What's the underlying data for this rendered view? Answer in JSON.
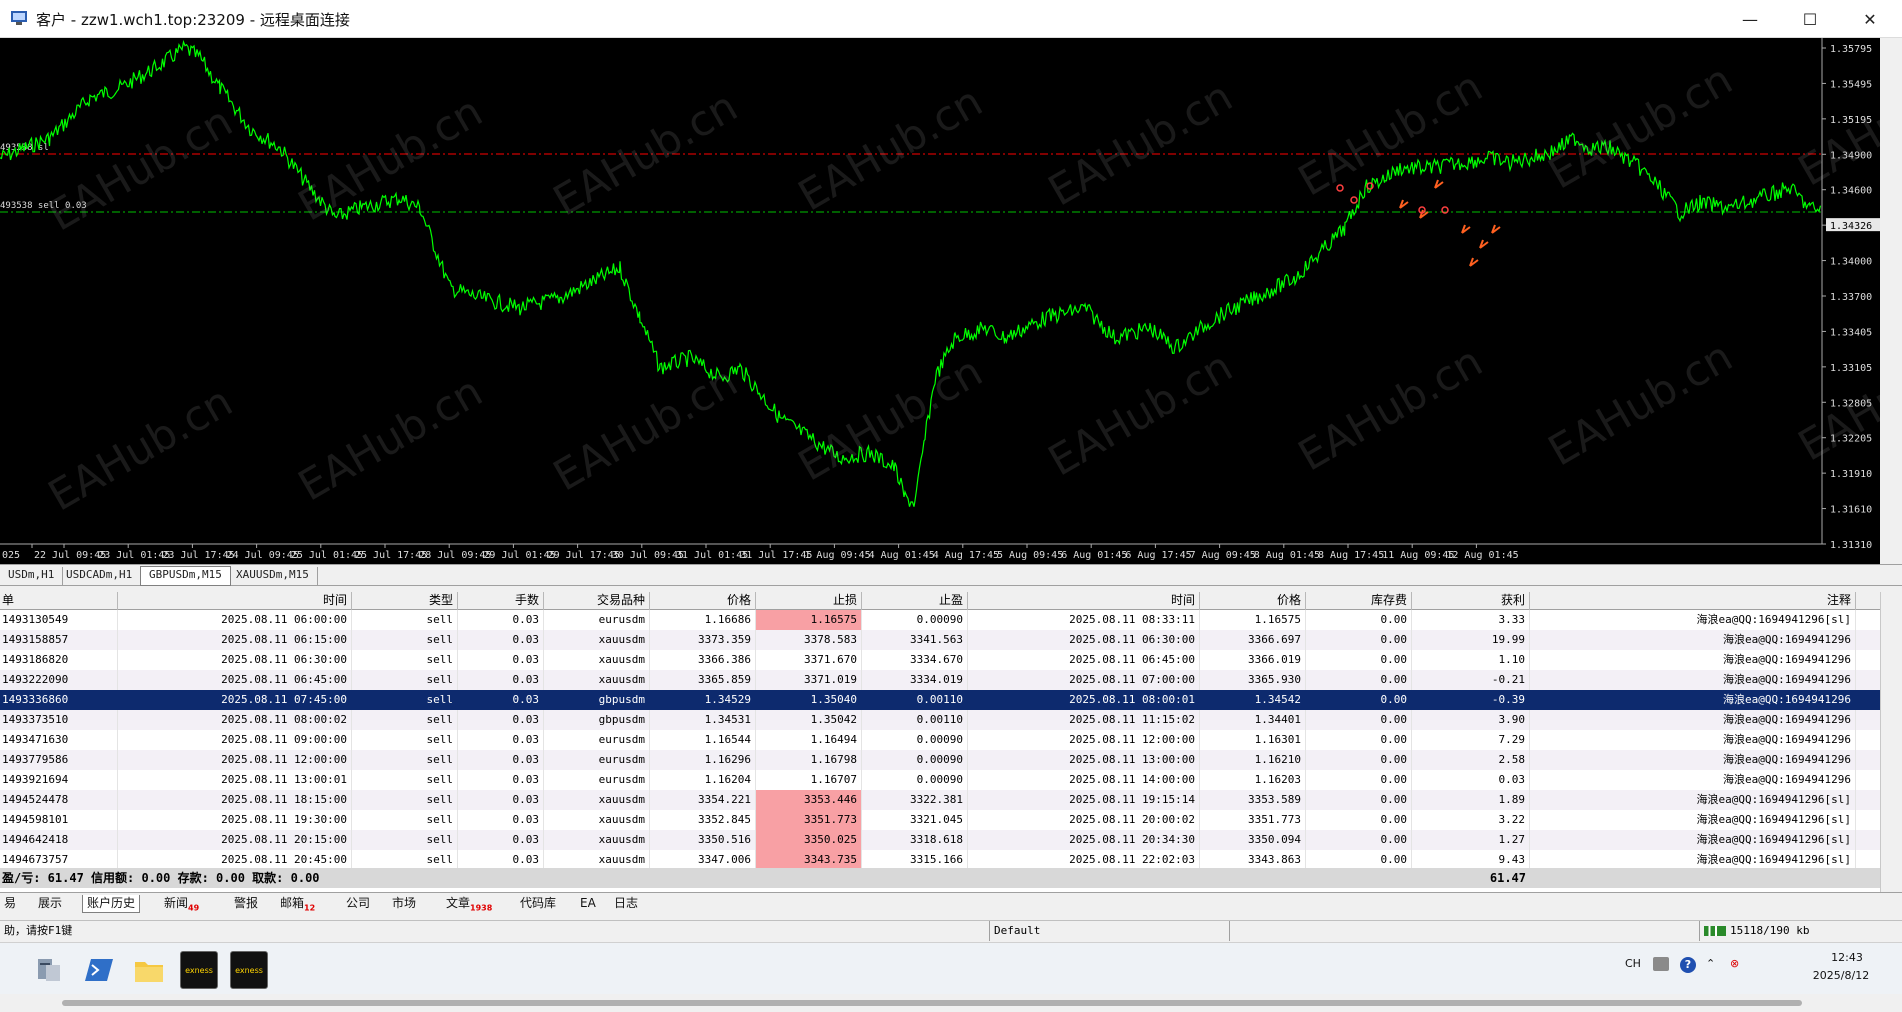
{
  "window": {
    "title": "客户 - zzw1.wch1.top:23209 - 远程桌面连接",
    "minimize_glyph": "—",
    "maximize_glyph": "☐",
    "close_glyph": "✕"
  },
  "chart": {
    "watermark": "EAHub.cn",
    "price_axis": [
      "1.35795",
      "1.35495",
      "1.35195",
      "1.34900",
      "1.34600",
      "1.34326",
      "1.34000",
      "1.33700",
      "1.33405",
      "1.33105",
      "1.32805",
      "1.32205",
      "1.31910",
      "1.31610",
      "1.31310"
    ],
    "current_price": "1.34326",
    "time_axis": [
      "025",
      "22 Jul 09:45",
      "23 Jul 01:45",
      "23 Jul 17:45",
      "24 Jul 09:45",
      "25 Jul 01:45",
      "25 Jul 17:45",
      "28 Jul 09:45",
      "29 Jul 01:45",
      "29 Jul 17:45",
      "30 Jul 09:45",
      "31 Jul 01:45",
      "31 Jul 17:45",
      "1 Aug 09:45",
      "4 Aug 01:45",
      "4 Aug 17:45",
      "5 Aug 09:45",
      "6 Aug 01:45",
      "6 Aug 17:45",
      "7 Aug 09:45",
      "8 Aug 01:45",
      "8 Aug 17:45",
      "11 Aug 09:45",
      "12 Aug 01:45"
    ],
    "order_labels": [
      "493538 sl",
      "493538 sell 0.03"
    ],
    "colors": {
      "price": "#00ff00",
      "sl_line": "#ff0000",
      "entry_line": "#00c000"
    }
  },
  "symbol_tabs": [
    "USDm,H1",
    "USDCADm,H1",
    "GBPUSDm,M15",
    "XAUUSDm,M15"
  ],
  "symbol_tabs_active": "GBPUSDm,M15",
  "table": {
    "headers": [
      "单",
      "时间",
      "类型",
      "手数",
      "交易品种",
      "价格",
      "止损",
      "止盈",
      "时间",
      "价格",
      "库存费",
      "获利",
      "注释"
    ],
    "rows": [
      [
        "1493130549",
        "2025.08.11 06:00:00",
        "sell",
        "0.03",
        "eurusdm",
        "1.16686",
        "1.16575",
        "0.00090",
        "2025.08.11 08:33:11",
        "1.16575",
        "0.00",
        "3.33",
        "海浪ea@QQ:1694941296[sl]"
      ],
      [
        "1493158857",
        "2025.08.11 06:15:00",
        "sell",
        "0.03",
        "xauusdm",
        "3373.359",
        "3378.583",
        "3341.563",
        "2025.08.11 06:30:00",
        "3366.697",
        "0.00",
        "19.99",
        "海浪ea@QQ:1694941296"
      ],
      [
        "1493186820",
        "2025.08.11 06:30:00",
        "sell",
        "0.03",
        "xauusdm",
        "3366.386",
        "3371.670",
        "3334.670",
        "2025.08.11 06:45:00",
        "3366.019",
        "0.00",
        "1.10",
        "海浪ea@QQ:1694941296"
      ],
      [
        "1493222090",
        "2025.08.11 06:45:00",
        "sell",
        "0.03",
        "xauusdm",
        "3365.859",
        "3371.019",
        "3334.019",
        "2025.08.11 07:00:00",
        "3365.930",
        "0.00",
        "-0.21",
        "海浪ea@QQ:1694941296"
      ],
      [
        "1493336860",
        "2025.08.11 07:45:00",
        "sell",
        "0.03",
        "gbpusdm",
        "1.34529",
        "1.35040",
        "0.00110",
        "2025.08.11 08:00:01",
        "1.34542",
        "0.00",
        "-0.39",
        "海浪ea@QQ:1694941296"
      ],
      [
        "1493373510",
        "2025.08.11 08:00:02",
        "sell",
        "0.03",
        "gbpusdm",
        "1.34531",
        "1.35042",
        "0.00110",
        "2025.08.11 11:15:02",
        "1.34401",
        "0.00",
        "3.90",
        "海浪ea@QQ:1694941296"
      ],
      [
        "1493471630",
        "2025.08.11 09:00:00",
        "sell",
        "0.03",
        "eurusdm",
        "1.16544",
        "1.16494",
        "0.00090",
        "2025.08.11 12:00:00",
        "1.16301",
        "0.00",
        "7.29",
        "海浪ea@QQ:1694941296"
      ],
      [
        "1493779586",
        "2025.08.11 12:00:00",
        "sell",
        "0.03",
        "eurusdm",
        "1.16296",
        "1.16798",
        "0.00090",
        "2025.08.11 13:00:00",
        "1.16210",
        "0.00",
        "2.58",
        "海浪ea@QQ:1694941296"
      ],
      [
        "1493921694",
        "2025.08.11 13:00:01",
        "sell",
        "0.03",
        "eurusdm",
        "1.16204",
        "1.16707",
        "0.00090",
        "2025.08.11 14:00:00",
        "1.16203",
        "0.00",
        "0.03",
        "海浪ea@QQ:1694941296"
      ],
      [
        "1494524478",
        "2025.08.11 18:15:00",
        "sell",
        "0.03",
        "xauusdm",
        "3354.221",
        "3353.446",
        "3322.381",
        "2025.08.11 19:15:14",
        "3353.589",
        "0.00",
        "1.89",
        "海浪ea@QQ:1694941296[sl]"
      ],
      [
        "1494598101",
        "2025.08.11 19:30:00",
        "sell",
        "0.03",
        "xauusdm",
        "3352.845",
        "3351.773",
        "3321.045",
        "2025.08.11 20:00:02",
        "3351.773",
        "0.00",
        "3.22",
        "海浪ea@QQ:1694941296[sl]"
      ],
      [
        "1494642418",
        "2025.08.11 20:15:00",
        "sell",
        "0.03",
        "xauusdm",
        "3350.516",
        "3350.025",
        "3318.618",
        "2025.08.11 20:34:30",
        "3350.094",
        "0.00",
        "1.27",
        "海浪ea@QQ:1694941296[sl]"
      ],
      [
        "1494673757",
        "2025.08.11 20:45:00",
        "sell",
        "0.03",
        "xauusdm",
        "3347.006",
        "3343.735",
        "3315.166",
        "2025.08.11 22:02:03",
        "3343.863",
        "0.00",
        "9.43",
        "海浪ea@QQ:1694941296[sl]"
      ]
    ],
    "selected_row": 4,
    "highlight_sl_rows": [
      0,
      9,
      10,
      11,
      12
    ],
    "summary": {
      "text": "盈/亏: 61.47  信用额: 0.00  存款: 0.00  取款: 0.00",
      "total": "61.47"
    }
  },
  "bottom_tabs": [
    {
      "label": "易",
      "badge": ""
    },
    {
      "label": "展示",
      "badge": ""
    },
    {
      "label": "账户历史",
      "badge": ""
    },
    {
      "label": "新闻",
      "badge": "49"
    },
    {
      "label": "警报",
      "badge": ""
    },
    {
      "label": "邮箱",
      "badge": "12"
    },
    {
      "label": "公司",
      "badge": ""
    },
    {
      "label": "市场",
      "badge": ""
    },
    {
      "label": "文章",
      "badge": "1938"
    },
    {
      "label": "代码库",
      "badge": ""
    },
    {
      "label": "EA",
      "badge": ""
    },
    {
      "label": "日志",
      "badge": ""
    }
  ],
  "bottom_tabs_active": "账户历史",
  "status": {
    "help": "助，请按F1键",
    "profile": "Default",
    "traffic": "15118/190 kb"
  },
  "taskbar": {
    "icons": [
      "server-icon",
      "powershell-icon",
      "folder-icon",
      "exness-terminal-icon",
      "exness-terminal-icon"
    ],
    "exness_label": "exness",
    "ime": "CH",
    "time": "12:43",
    "date": "2025/8/12"
  }
}
